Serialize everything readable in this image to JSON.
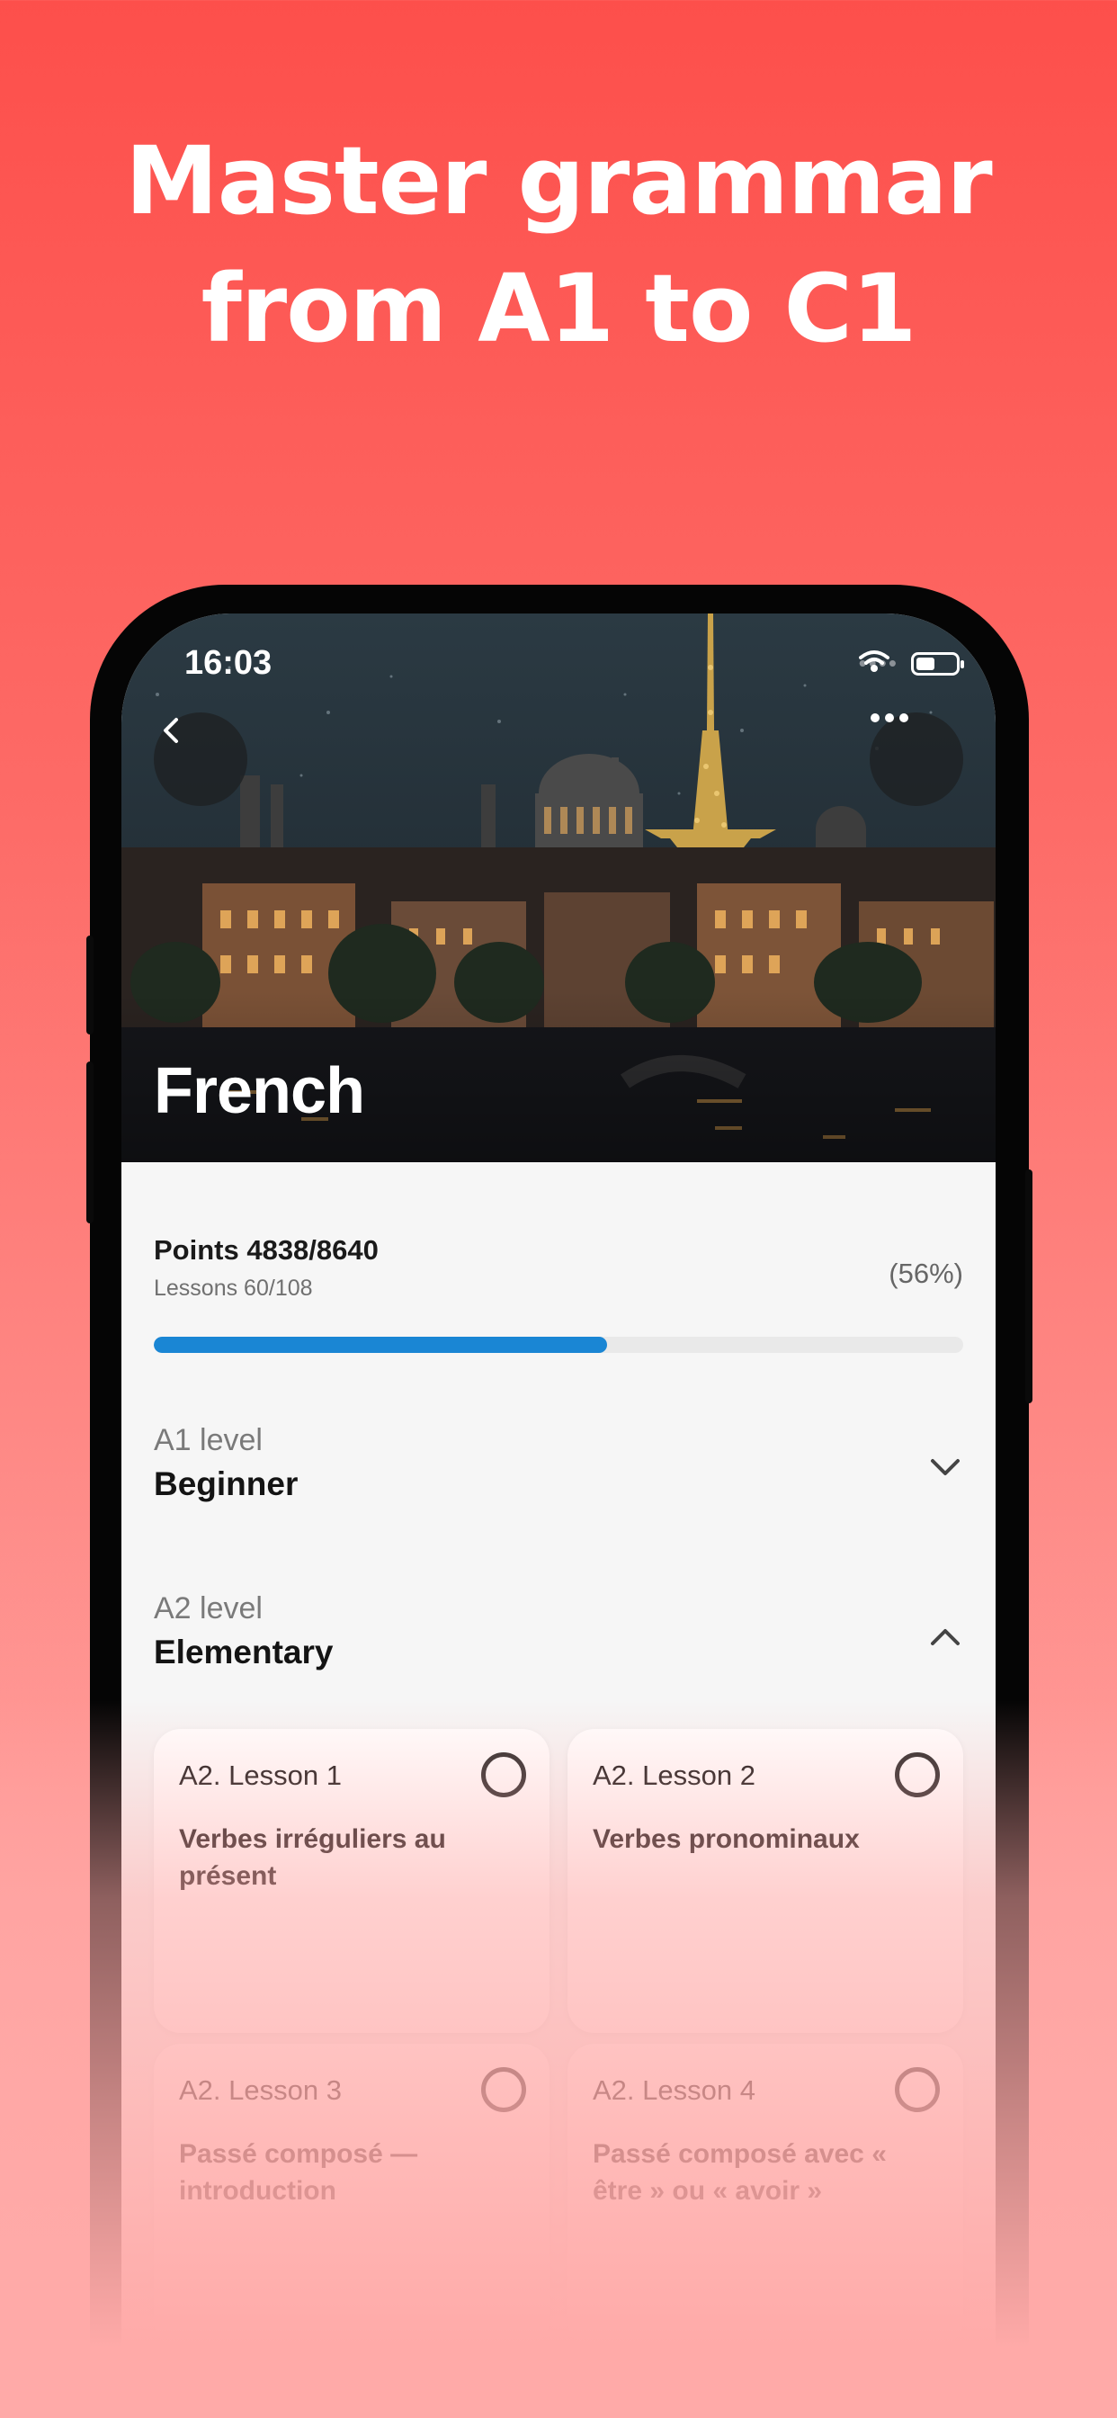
{
  "headline": {
    "line1": "Master grammar",
    "line2": "from A1 to C1"
  },
  "status_bar": {
    "time": "16:03"
  },
  "course": {
    "title": "French"
  },
  "progress": {
    "points": "Points 4838/8640",
    "lessons": "Lessons 60/108",
    "percent_label": "(56%)",
    "fraction": 0.56
  },
  "levels": [
    {
      "sub": "A1 level",
      "name": "Beginner",
      "expanded": false
    },
    {
      "sub": "A2 level",
      "name": "Elementary",
      "expanded": true
    }
  ],
  "lessons": [
    {
      "label": "A2. Lesson 1",
      "title": "Verbes irréguliers au présent"
    },
    {
      "label": "A2. Lesson 2",
      "title": "Verbes pronominaux"
    },
    {
      "label": "A2. Lesson 3",
      "title": "Passé composé — introduction"
    },
    {
      "label": "A2. Lesson 4",
      "title": "Passé composé avec « être » ou « avoir »"
    }
  ],
  "colors": {
    "accent": "#1a86d4",
    "background": "#fd4f4b"
  },
  "icons": {
    "back": "chevron-left-icon",
    "more": "more-horizontal-icon",
    "expand": "chevron-down-icon",
    "collapse": "chevron-up-icon"
  }
}
